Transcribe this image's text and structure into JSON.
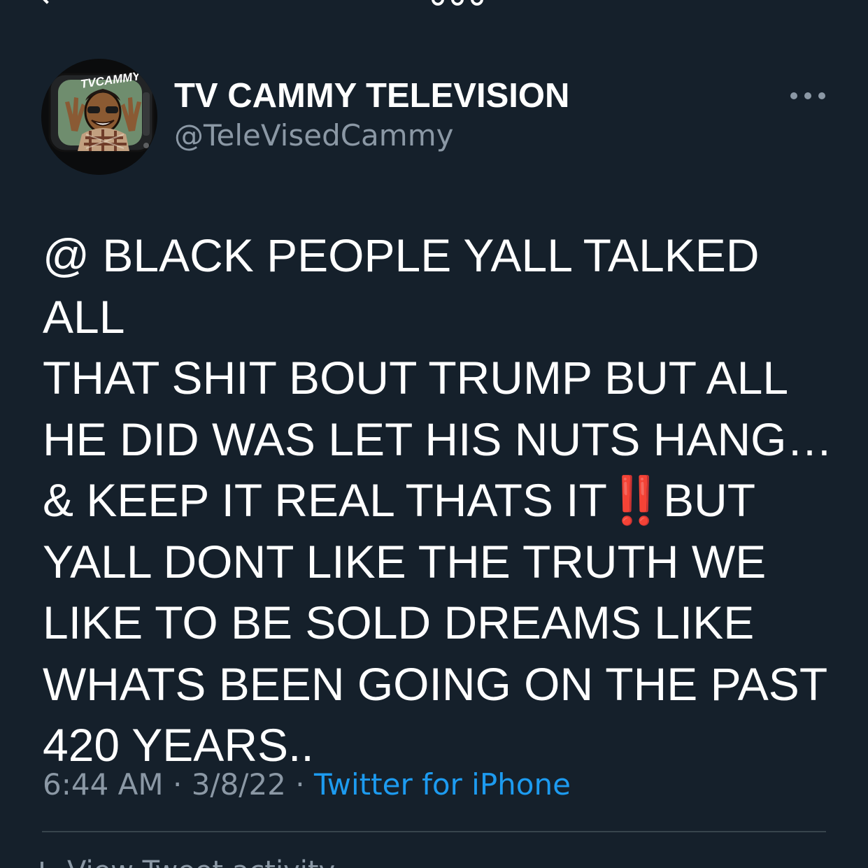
{
  "tweet": {
    "author": {
      "display_name": "TV CAMMY TELEVISION",
      "handle": "@TeleVisedCammy",
      "avatar_text": "TVCAMMY",
      "avatar_icon": "cartoon-tv-avatar-icon"
    },
    "more_icon": "more-dots-icon",
    "text_parts": {
      "part1": "@ BLACK PEOPLE YALL TALKED ALL\nTHAT SHIT BOUT TRUMP BUT ALL\nHE DID WAS LET HIS NUTS HANG…\n& KEEP IT REAL THATS IT",
      "emoji": "‼️",
      "part2": "BUT\nYALL DONT LIKE THE TRUTH WE\nLIKE TO BE SOLD DREAMS LIKE\nWHATS BEEN GOING ON THE PAST\n420 YEARS.."
    },
    "meta": {
      "time": "6:44 AM",
      "separator": " · ",
      "date": "3/8/22",
      "source": "Twitter for iPhone"
    },
    "activity_label": "View Tweet activity"
  },
  "colors": {
    "background": "#15202b",
    "text": "#ffffff",
    "secondary": "#8b98a5",
    "link": "#1d9bf0",
    "divider": "#38444d",
    "emoji": "#e8262d"
  }
}
